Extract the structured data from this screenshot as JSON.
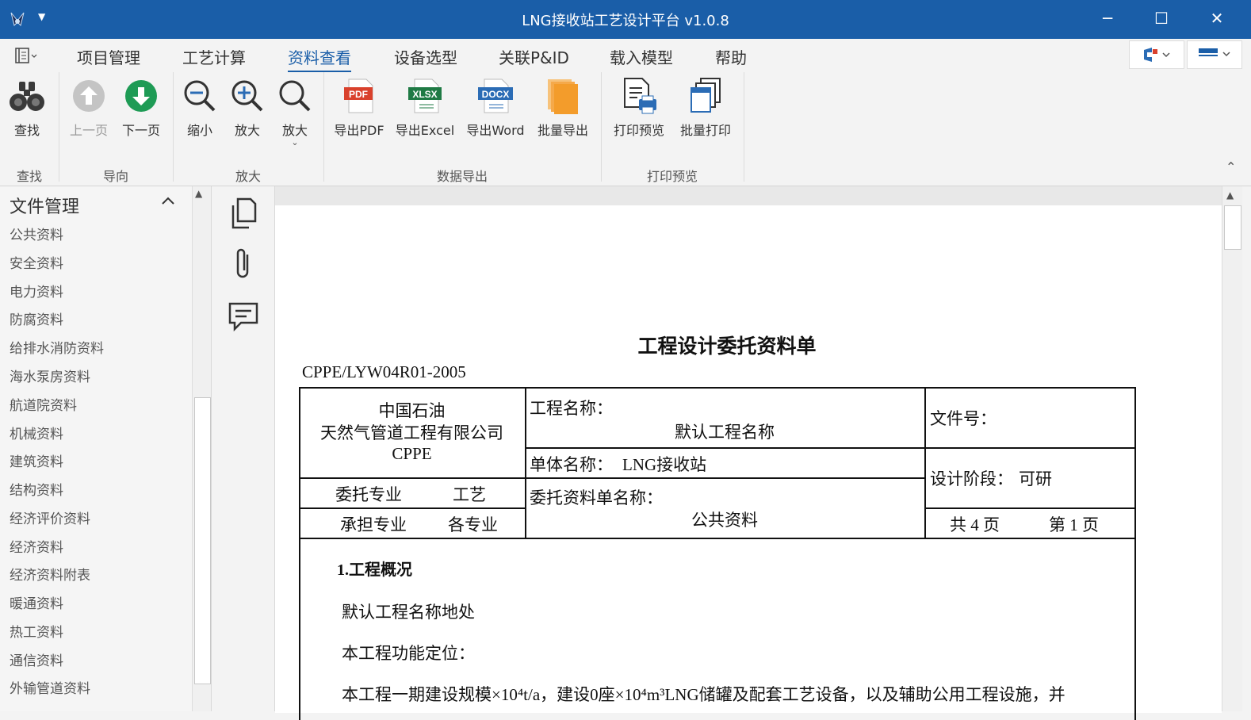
{
  "window": {
    "title": "LNG接收站工艺设计平台 v1.0.8",
    "controls": {
      "minimize": "─",
      "maximize": "☐",
      "close": "✕"
    }
  },
  "menu": {
    "items": [
      "项目管理",
      "工艺计算",
      "资料查看",
      "设备选型",
      "关联P&ID",
      "载入模型",
      "帮助"
    ],
    "active": "资料查看"
  },
  "ribbon": {
    "groups": {
      "find": "查找",
      "nav": "导向",
      "zoom": "放大",
      "export": "数据导出",
      "print": "打印预览"
    },
    "buttons": {
      "find": "查找",
      "prev": "上一页",
      "next": "下一页",
      "zoom_out": "缩小",
      "zoom_in": "放大",
      "zoom_menu": "放大",
      "pdf": "导出PDF",
      "excel": "导出Excel",
      "word": "导出Word",
      "batch_export": "批量导出",
      "print_preview": "打印预览",
      "batch_print": "批量打印"
    },
    "icon_text": {
      "pdf": "PDF",
      "xlsx": "XLSX",
      "docx": "DOCX"
    }
  },
  "file_panel": {
    "title": "文件管理",
    "items": [
      "公共资料",
      "安全资料",
      "电力资料",
      "防腐资料",
      "给排水消防资料",
      "海水泵房资料",
      "航道院资料",
      "机械资料",
      "建筑资料",
      "结构资料",
      "经济评价资料",
      "经济资料",
      "经济资料附表",
      "暖通资料",
      "热工资料",
      "通信资料",
      "外输管道资料"
    ]
  },
  "document": {
    "title": "工程设计委托资料单",
    "code": "CPPE/LYW04R01-2005",
    "company_line1": "中国石油",
    "company_line2": "天然气管道工程有限公司",
    "company_line3": "CPPE",
    "project_label": "工程名称：",
    "project_value": "默认工程名称",
    "file_no_label": "文件号：",
    "unit_label": "单体名称：",
    "unit_value": "LNG接收站",
    "stage_label": "设计阶段：",
    "stage_value": "可研",
    "entrust_major_label": "委托专业",
    "entrust_major_value": "工艺",
    "undertake_major_label": "承担专业",
    "undertake_major_value": "各专业",
    "sheet_name_label": "委托资料单名称：",
    "sheet_name_value": "公共资料",
    "total_pages": "共 4 页",
    "current_page": "第 1 页",
    "section1_title": "1.工程概况",
    "para1": "默认工程名称地处",
    "para2": "本工程功能定位：",
    "para3": "本工程一期建设规模×10⁴t/a，建设0座×10⁴m³LNG储罐及配套工艺设备，以及辅助公用工程设施，并"
  },
  "colors": {
    "titlebar": "#1a5ea8",
    "accent": "#1a5ea8",
    "next_green": "#1e9b55",
    "pdf_red": "#d9412c",
    "xlsx_green": "#1f7a44",
    "docx_blue": "#2b6cb5",
    "batch_orange": "#f39c2b"
  }
}
